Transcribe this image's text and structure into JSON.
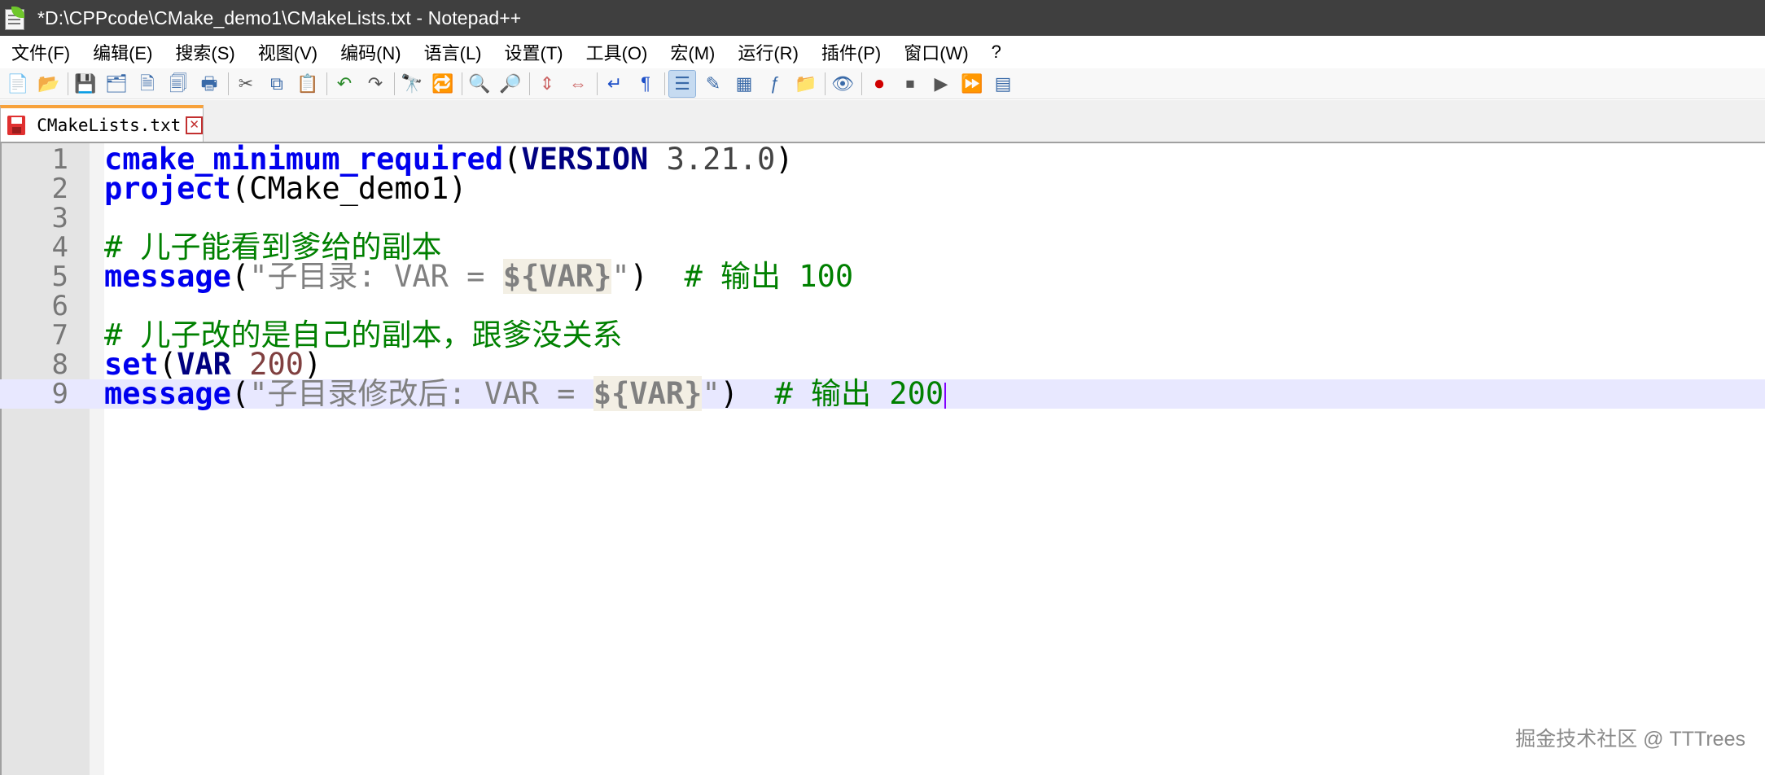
{
  "window": {
    "title": "*D:\\CPPcode\\CMake_demo1\\CMakeLists.txt - Notepad++",
    "app_icon": "notepad-plus-plus-icon"
  },
  "menu": {
    "items": [
      "文件(F)",
      "编辑(E)",
      "搜索(S)",
      "视图(V)",
      "编码(N)",
      "语言(L)",
      "设置(T)",
      "工具(O)",
      "宏(M)",
      "运行(R)",
      "插件(P)",
      "窗口(W)",
      "?"
    ]
  },
  "toolbar": {
    "icons": [
      "new-file-icon",
      "open-file-icon",
      "save-icon",
      "save-all-icon",
      "close-icon",
      "close-all-icon",
      "print-icon",
      "cut-icon",
      "copy-icon",
      "paste-icon",
      "undo-icon",
      "redo-icon",
      "find-icon",
      "replace-icon",
      "zoom-in-icon",
      "zoom-out-icon",
      "sync-vertical-icon",
      "sync-horizontal-icon",
      "word-wrap-icon",
      "show-all-characters-icon",
      "indent-guide-icon",
      "user-language-icon",
      "document-map-icon",
      "function-list-icon",
      "folder-as-workspace-icon",
      "monitoring-icon",
      "record-macro-icon",
      "stop-macro-icon",
      "play-macro-icon",
      "run-macro-multiple-icon",
      "save-macro-icon"
    ]
  },
  "tab": {
    "label": "CMakeLists.txt"
  },
  "editor": {
    "lines": [
      {
        "n": "1",
        "tokens": [
          [
            "kw",
            "cmake_minimum_required"
          ],
          [
            "op",
            "("
          ],
          [
            "var",
            "VERSION"
          ],
          [
            "num-plain",
            " 3.21.0"
          ],
          [
            "op",
            ")"
          ]
        ]
      },
      {
        "n": "2",
        "tokens": [
          [
            "kw",
            "project"
          ],
          [
            "op",
            "("
          ],
          [
            "op",
            "CMake_demo1"
          ],
          [
            "op",
            ")"
          ]
        ]
      },
      {
        "n": "3",
        "tokens": []
      },
      {
        "n": "4",
        "tokens": [
          [
            "cmt",
            "# 儿子能看到爹给的副本"
          ]
        ]
      },
      {
        "n": "5",
        "tokens": [
          [
            "kw",
            "message"
          ],
          [
            "op",
            "("
          ],
          [
            "str",
            "\"子目录: VAR = "
          ],
          [
            "varref",
            "${VAR}"
          ],
          [
            "str",
            "\""
          ],
          [
            "op",
            ")"
          ],
          [
            "op",
            "  "
          ],
          [
            "cmt",
            "# 输出 100"
          ]
        ]
      },
      {
        "n": "6",
        "tokens": []
      },
      {
        "n": "7",
        "tokens": [
          [
            "cmt",
            "# 儿子改的是自己的副本，跟爹没关系"
          ]
        ]
      },
      {
        "n": "8",
        "tokens": [
          [
            "kw",
            "set"
          ],
          [
            "op",
            "("
          ],
          [
            "var",
            "VAR"
          ],
          [
            "num",
            " 200"
          ],
          [
            "op",
            ")"
          ]
        ]
      },
      {
        "n": "9",
        "tokens": [
          [
            "kw",
            "message"
          ],
          [
            "op",
            "("
          ],
          [
            "str",
            "\"子目录修改后: VAR = "
          ],
          [
            "varref",
            "${VAR}"
          ],
          [
            "str",
            "\""
          ],
          [
            "op",
            ")"
          ],
          [
            "op",
            "  "
          ],
          [
            "cmt",
            "# 输出 200"
          ]
        ]
      }
    ],
    "current_line": "9"
  },
  "watermark": "掘金技术社区 @ TTTrees"
}
